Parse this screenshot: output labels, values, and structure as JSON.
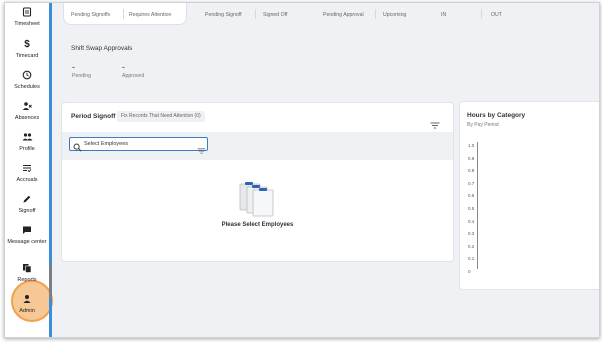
{
  "sidebar": {
    "items": [
      {
        "label": "Timesheet",
        "icon": "timesheet-icon"
      },
      {
        "label": "Timecard",
        "icon": "dollar-icon"
      },
      {
        "label": "Schedules",
        "icon": "clock-icon"
      },
      {
        "label": "Absences",
        "icon": "person-off-icon"
      },
      {
        "label": "Profile",
        "icon": "people-icon"
      },
      {
        "label": "Accruals",
        "icon": "list-icon"
      },
      {
        "label": "Signoff",
        "icon": "edit-icon"
      },
      {
        "label": "Message center",
        "icon": "chat-icon"
      },
      {
        "label": "Reports",
        "icon": "copy-icon"
      },
      {
        "label": "Admin",
        "icon": "person-icon"
      }
    ]
  },
  "topbar": {
    "labels": [
      "Pending Signoffs",
      "Requires Attention",
      "Pending Signoff",
      "Signed Off",
      "Pending Approval",
      "Upcoming",
      "IN",
      "OUT"
    ]
  },
  "shift_swap": {
    "title": "Shift Swap Approvals",
    "items": [
      {
        "value": "-",
        "label": "Pending"
      },
      {
        "value": "-",
        "label": "Approved"
      }
    ]
  },
  "period_signoff": {
    "title": "Period Signoff",
    "chip": "Fix Records That Need Attention (0)",
    "search_placeholder": "Select Employees",
    "empty_message": "Please Select Employees"
  },
  "hours_by_category": {
    "title": "Hours by Category",
    "subtitle": "By Pay Period"
  },
  "chart_data": {
    "type": "bar",
    "title": "Hours by Category",
    "subtitle": "By Pay Period",
    "categories": [],
    "series": [],
    "ylim": [
      0,
      1.0
    ],
    "yticks": [
      "1.0",
      "0.9",
      "0.8",
      "0.7",
      "0.6",
      "0.5",
      "0.4",
      "0.3",
      "0.2",
      "0.1",
      "0"
    ]
  },
  "colors": {
    "accent": "#3a8fd8",
    "highlight": "#f2a14e",
    "highlight_fill": "#f6c896"
  }
}
